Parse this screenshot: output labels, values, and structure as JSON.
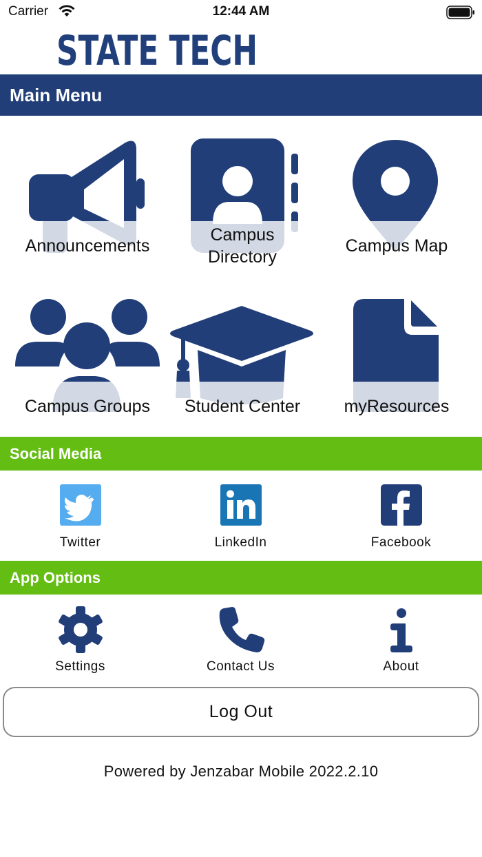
{
  "status_bar": {
    "carrier": "Carrier",
    "time": "12:44 AM"
  },
  "logo": {
    "text": "STATE TECH"
  },
  "main_menu": {
    "title": "Main Menu",
    "items": [
      {
        "label": "Announcements",
        "icon": "megaphone-icon"
      },
      {
        "label": "Campus Directory",
        "icon": "address-book-icon"
      },
      {
        "label": "Campus Map",
        "icon": "map-pin-icon"
      },
      {
        "label": "Campus Groups",
        "icon": "users-group-icon"
      },
      {
        "label": "Student Center",
        "icon": "graduation-cap-icon"
      },
      {
        "label": "myResources",
        "icon": "document-icon"
      }
    ]
  },
  "social_media": {
    "title": "Social Media",
    "items": [
      {
        "label": "Twitter",
        "icon": "twitter-icon",
        "color": "#55acee"
      },
      {
        "label": "LinkedIn",
        "icon": "linkedin-icon",
        "color": "#1a75b4"
      },
      {
        "label": "Facebook",
        "icon": "facebook-icon",
        "color": "#213e79"
      }
    ]
  },
  "app_options": {
    "title": "App Options",
    "items": [
      {
        "label": "Settings",
        "icon": "gear-icon"
      },
      {
        "label": "Contact Us",
        "icon": "phone-icon"
      },
      {
        "label": "About",
        "icon": "info-icon"
      }
    ]
  },
  "logout_label": "Log Out",
  "footer": "Powered by Jenzabar Mobile 2022.2.10",
  "colors": {
    "primary": "#213e79",
    "accent_green": "#64bd13",
    "icon_fade": "#d6dbe6"
  }
}
